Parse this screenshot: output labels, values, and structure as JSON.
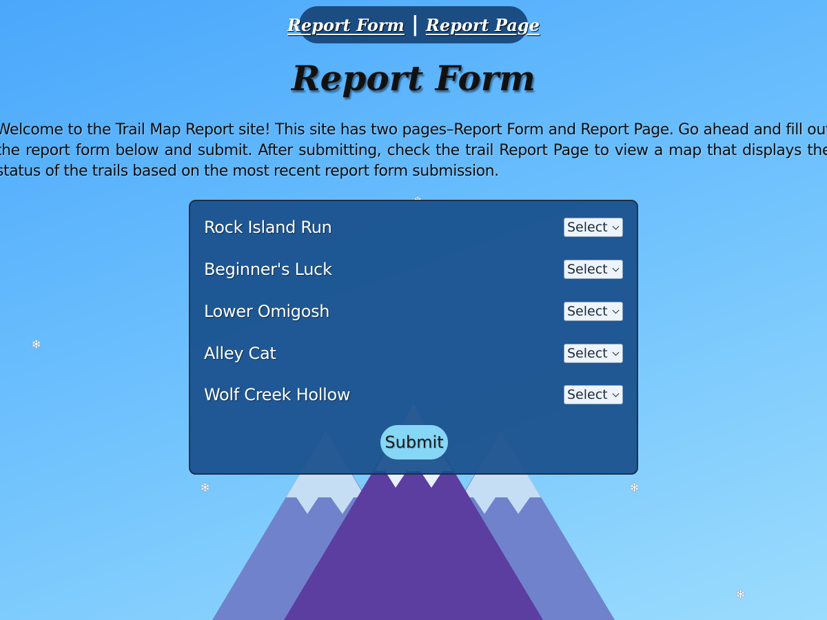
{
  "nav": {
    "form_link": "Report Form",
    "separator": "|",
    "page_link": "Report Page"
  },
  "page_title": "Report Form",
  "intro": "Welcome to the Trail Map Report site! This site has two pages–Report Form and Report Page. Go ahead and fill out the report form below and submit. After submitting, check the trail Report Page to view a map that displays the status of the trails based on the most recent report form submission.",
  "form": {
    "trails": [
      {
        "label": "Rock Island Run",
        "select_value": "Select"
      },
      {
        "label": "Beginner's Luck",
        "select_value": "Select"
      },
      {
        "label": "Lower Omigosh",
        "select_value": "Select"
      },
      {
        "label": "Alley Cat",
        "select_value": "Select"
      },
      {
        "label": "Wolf Creek Hollow",
        "select_value": "Select"
      }
    ],
    "submit_label": "Submit"
  },
  "snowflake_glyph": "❄",
  "colors": {
    "nav_pill": "#1b4d83",
    "panel": "#19508c",
    "submit": "#86d6f6",
    "mountain_center": "#5b3ea0",
    "mountain_side": "#6f80cc",
    "snowcap": "#e8f1fb"
  }
}
